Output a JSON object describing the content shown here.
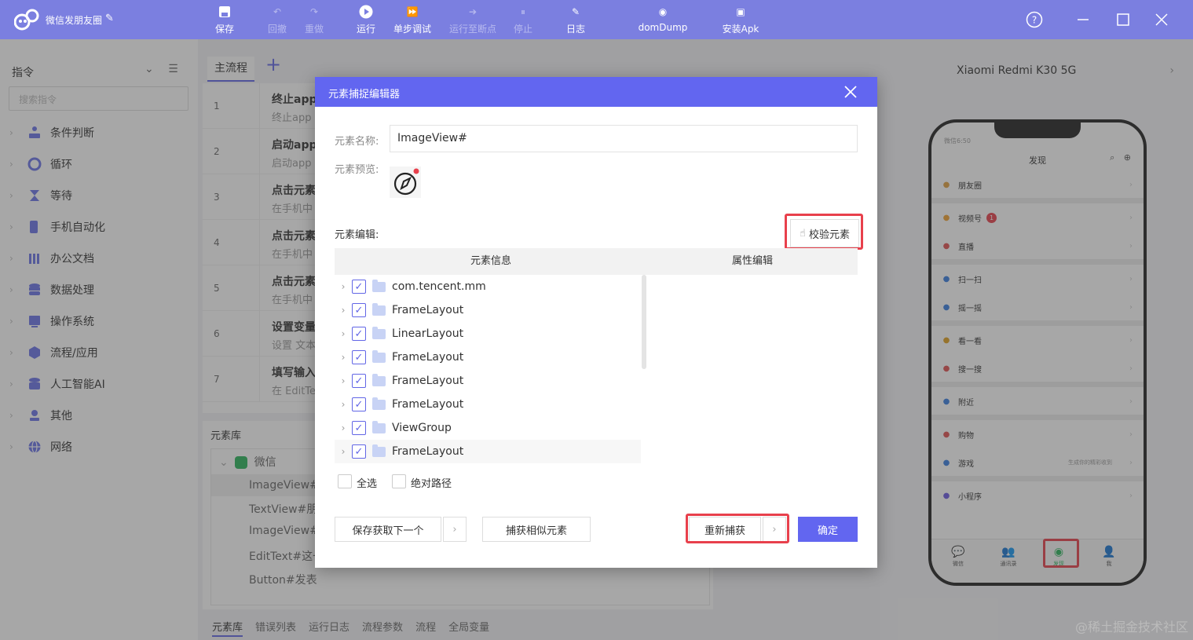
{
  "app": {
    "title": "微信发朋友圈"
  },
  "toolbar": {
    "save": "保存",
    "undo": "回撤",
    "redo": "重做",
    "run": "运行",
    "step_debug": "单步调试",
    "run_to_breakpoint": "运行至断点",
    "stop": "停止",
    "log": "日志",
    "domdump": "domDump",
    "install_apk": "安装Apk"
  },
  "sidebar": {
    "title": "指令",
    "search_placeholder": "搜索指令",
    "items": [
      {
        "label": "条件判断",
        "icon": "condition-icon"
      },
      {
        "label": "循环",
        "icon": "loop-icon"
      },
      {
        "label": "等待",
        "icon": "hourglass-icon"
      },
      {
        "label": "手机自动化",
        "icon": "phone-automation-icon"
      },
      {
        "label": "办公文档",
        "icon": "document-icon"
      },
      {
        "label": "数据处理",
        "icon": "database-icon"
      },
      {
        "label": "操作系统",
        "icon": "os-icon"
      },
      {
        "label": "流程/应用",
        "icon": "cube-icon"
      },
      {
        "label": "人工智能AI",
        "icon": "ai-icon"
      },
      {
        "label": "其他",
        "icon": "other-icon"
      },
      {
        "label": "网络",
        "icon": "globe-icon"
      }
    ]
  },
  "flow": {
    "tab_main": "主流程",
    "steps": [
      {
        "num": "1",
        "title": "终止app",
        "desc": "终止app"
      },
      {
        "num": "2",
        "title": "启动app",
        "desc": "启动app"
      },
      {
        "num": "3",
        "title": "点击元素",
        "desc": "在手机中"
      },
      {
        "num": "4",
        "title": "点击元素",
        "desc": "在手机中"
      },
      {
        "num": "5",
        "title": "点击元素",
        "desc": "在手机中"
      },
      {
        "num": "6",
        "title": "设置变量",
        "desc": "设置 文本"
      },
      {
        "num": "7",
        "title": "填写输入",
        "desc": "在 EditTe"
      }
    ]
  },
  "element_library": {
    "title": "元素库",
    "group": "微信",
    "items": [
      "ImageView#",
      "TextView#朋",
      "ImageView#",
      "EditText#这一",
      "Button#发表"
    ]
  },
  "bottom_tabs": [
    "元素库",
    "错误列表",
    "运行日志",
    "流程参数",
    "流程",
    "全局变量"
  ],
  "device": {
    "name": "Xiaomi Redmi K30 5G",
    "status": "微信6:50",
    "screen_title": "发现",
    "menu": [
      {
        "label": "朋友圈",
        "icon": "moments-icon",
        "color": "#e0a040"
      },
      {
        "label": "视频号",
        "icon": "channels-icon",
        "color": "#f0a030",
        "badge": "1"
      },
      {
        "label": "直播",
        "icon": "live-icon",
        "color": "#e05050"
      },
      {
        "label": "扫一扫",
        "icon": "scan-icon",
        "color": "#3a7ee0"
      },
      {
        "label": "摇一摇",
        "icon": "shake-icon",
        "color": "#3a7ee0"
      },
      {
        "label": "看一看",
        "icon": "look-icon",
        "color": "#e0a020"
      },
      {
        "label": "搜一搜",
        "icon": "search-icon",
        "color": "#e05050"
      },
      {
        "label": "附近",
        "icon": "nearby-icon",
        "color": "#3a7ee0"
      },
      {
        "label": "购物",
        "icon": "shopping-icon",
        "color": "#e05050"
      },
      {
        "label": "游戏",
        "icon": "game-icon",
        "color": "#3a7ee0",
        "extra": "生成你的精彩收到"
      },
      {
        "label": "小程序",
        "icon": "miniprogram-icon",
        "color": "#6a5ae0"
      }
    ],
    "nav": [
      "微信",
      "通讯录",
      "发现",
      "我"
    ]
  },
  "dialog": {
    "title": "元素捕捉编辑器",
    "name_label": "元素名称:",
    "name_value": "ImageView#",
    "preview_label": "元素预览:",
    "edit_label": "元素编辑:",
    "verify_button": "校验元素",
    "col_info": "元素信息",
    "col_props": "属性编辑",
    "tree": [
      "com.tencent.mm",
      "FrameLayout",
      "LinearLayout",
      "FrameLayout",
      "FrameLayout",
      "FrameLayout",
      "ViewGroup",
      "FrameLayout"
    ],
    "select_all": "全选",
    "absolute_path": "绝对路径",
    "save_next": "保存获取下一个",
    "capture_similar": "捕获相似元素",
    "recapture": "重新捕获",
    "confirm": "确定"
  },
  "watermark": "@稀土掘金技术社区",
  "colors": {
    "accent": "#6266f0",
    "highlight": "#e8404c",
    "topbar": "#7b7fe0"
  }
}
